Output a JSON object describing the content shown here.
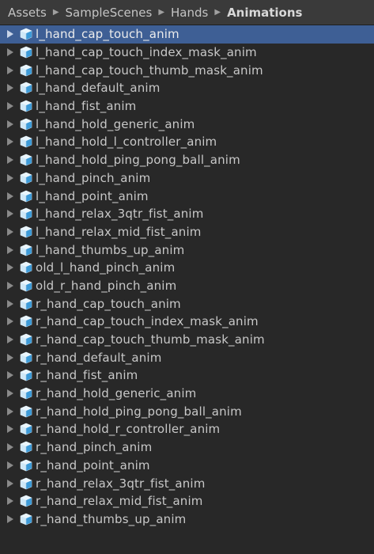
{
  "breadcrumb": {
    "items": [
      "Assets",
      "SampleScenes",
      "Hands"
    ],
    "current": "Animations",
    "separator": "▶"
  },
  "icons": {
    "expand": "triangle-right-icon",
    "asset": "animation-clip-icon"
  },
  "colors": {
    "background": "#282828",
    "header": "#3a3a3a",
    "selected": "#3e5f95",
    "text": "#c8c8c8",
    "icon_light": "#cfe8f7",
    "icon_blue": "#3d9bd8"
  },
  "selected_index": 0,
  "files": [
    "l_hand_cap_touch_anim",
    "l_hand_cap_touch_index_mask_anim",
    "l_hand_cap_touch_thumb_mask_anim",
    "l_hand_default_anim",
    "l_hand_fist_anim",
    "l_hand_hold_generic_anim",
    "l_hand_hold_l_controller_anim",
    "l_hand_hold_ping_pong_ball_anim",
    "l_hand_pinch_anim",
    "l_hand_point_anim",
    "l_hand_relax_3qtr_fist_anim",
    "l_hand_relax_mid_fist_anim",
    "l_hand_thumbs_up_anim",
    "old_l_hand_pinch_anim",
    "old_r_hand_pinch_anim",
    "r_hand_cap_touch_anim",
    "r_hand_cap_touch_index_mask_anim",
    "r_hand_cap_touch_thumb_mask_anim",
    "r_hand_default_anim",
    "r_hand_fist_anim",
    "r_hand_hold_generic_anim",
    "r_hand_hold_ping_pong_ball_anim",
    "r_hand_hold_r_controller_anim",
    "r_hand_pinch_anim",
    "r_hand_point_anim",
    "r_hand_relax_3qtr_fist_anim",
    "r_hand_relax_mid_fist_anim",
    "r_hand_thumbs_up_anim"
  ]
}
